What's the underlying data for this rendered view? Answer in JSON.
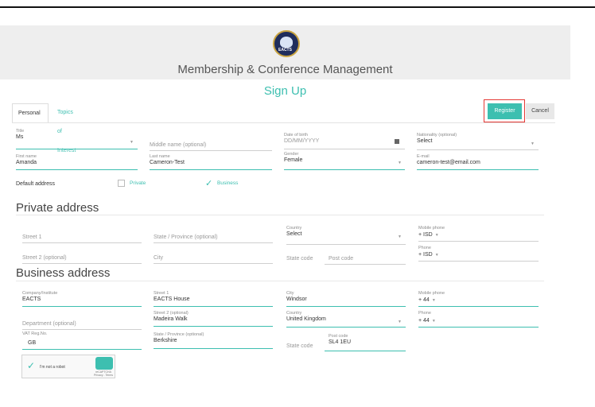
{
  "header": {
    "logo_text": "EACTS",
    "app_title": "Membership & Conference Management",
    "page_title": "Sign Up"
  },
  "tabs": [
    {
      "label": "Personal",
      "active": true
    },
    {
      "label": "Topics of Interest",
      "active": false
    }
  ],
  "buttons": {
    "register": "Register",
    "cancel": "Cancel"
  },
  "personal": {
    "title": {
      "label": "Title",
      "value": "Ms"
    },
    "middle_name": {
      "placeholder": "Middle name (optional)"
    },
    "dob": {
      "label": "Date of birth",
      "value": "DD/MM/YYYY"
    },
    "nationality": {
      "label": "Nationality (optional)",
      "value": "Select"
    },
    "first_name": {
      "label": "First name",
      "value": "Amanda"
    },
    "last_name": {
      "label": "Last name",
      "value": "Cameron-Test"
    },
    "gender": {
      "label": "Gender",
      "value": "Female"
    },
    "email": {
      "label": "E-mail",
      "value": "cameron-test@email.com"
    },
    "default_address": "Default address",
    "private_option": "Private",
    "business_option": "Business"
  },
  "private_address": {
    "heading": "Private address",
    "street1": "Street 1",
    "state": "State / Province (optional)",
    "country": {
      "label": "Country",
      "value": "Select"
    },
    "mobile": {
      "label": "Mobile phone",
      "prefix": "+",
      "value": "ISD"
    },
    "street2": "Street 2 (optional)",
    "city": "City",
    "state_code": "State code",
    "post_code": "Post code",
    "phone": {
      "label": "Phone",
      "prefix": "+",
      "value": "ISD"
    }
  },
  "business_address": {
    "heading": "Business address",
    "company": {
      "label": "Company/Institute",
      "value": "EACTS"
    },
    "street1": {
      "label": "Street 1",
      "value": "EACTS House"
    },
    "city": {
      "label": "City",
      "value": "Windsor"
    },
    "mobile": {
      "label": "Mobile phone",
      "value": "+ 44"
    },
    "department": "Department (optional)",
    "street2": {
      "label": "Street 2 (optional)",
      "value": "Madeira Walk"
    },
    "country": {
      "label": "Country",
      "value": "United Kingdom"
    },
    "phone": {
      "label": "Phone",
      "value": "+ 44"
    },
    "vat": {
      "label": "VAT Reg.No.",
      "value": "GB"
    },
    "state": {
      "label": "State / Province (optional)",
      "value": "Berkshire"
    },
    "state_code": "State code",
    "post_code": {
      "label": "Post code",
      "value": "SL4 1EU"
    }
  },
  "captcha": {
    "label": "I'm not a robot",
    "brand": "reCAPTCHA",
    "sub": "Privacy - Terms"
  },
  "colors": {
    "accent": "#3dbfb0",
    "highlight": "#e53935"
  }
}
